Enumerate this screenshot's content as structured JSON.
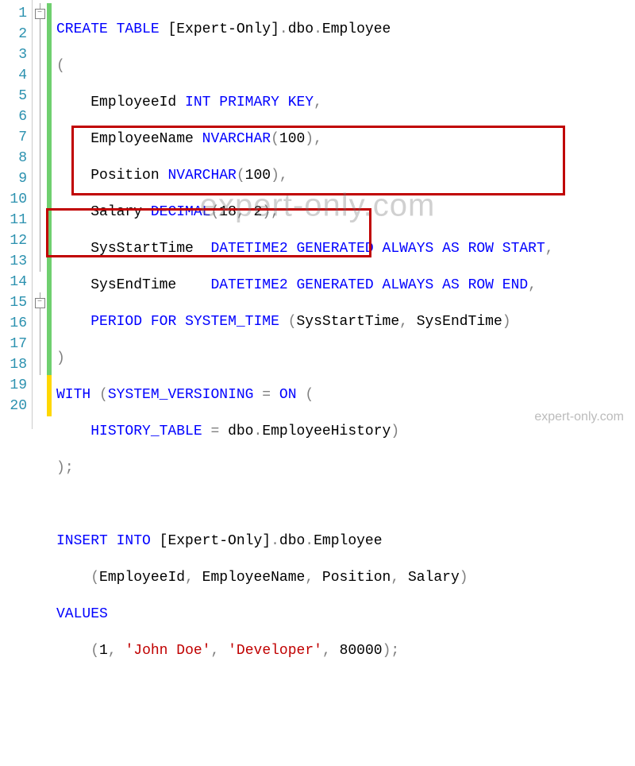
{
  "watermark": "expert-only.com",
  "corner_mark": "expert-only.com",
  "gutter": [
    "1",
    "2",
    "3",
    "4",
    "5",
    "6",
    "7",
    "8",
    "9",
    "10",
    "11",
    "12",
    "13",
    "14",
    "15",
    "16",
    "17",
    "18",
    "19",
    "20"
  ],
  "fold": {
    "minus": "−"
  },
  "lines": {
    "l1": {
      "a": "CREATE",
      "b": " ",
      "c": "TABLE",
      "d": " [Expert-Only]",
      "e": ".",
      "f": "dbo",
      "g": ".",
      "h": "Employee"
    },
    "l2": {
      "a": "(",
      "pad": ""
    },
    "l3": {
      "a": "EmployeeId ",
      "b": "INT",
      "c": " ",
      "d": "PRIMARY",
      "e": " ",
      "f": "KEY",
      "g": ","
    },
    "l4": {
      "a": "EmployeeName ",
      "b": "NVARCHAR",
      "c": "(",
      "d": "100",
      "e": ")",
      "f": ","
    },
    "l5": {
      "a": "Position ",
      "b": "NVARCHAR",
      "c": "(",
      "d": "100",
      "e": ")",
      "f": ","
    },
    "l6": {
      "a": "Salary ",
      "b": "DECIMAL",
      "c": "(",
      "d": "18",
      "e": ",",
      "f": " ",
      "g": "2",
      "h": ")",
      "i": ","
    },
    "l7": {
      "a": "SysStartTime  ",
      "b": "DATETIME2",
      "c": " ",
      "d": "GENERATED",
      "e": " ",
      "f": "ALWAYS",
      "g": " ",
      "h": "AS",
      "i": " ",
      "j": "ROW",
      "k": " ",
      "l": "START",
      "m": ","
    },
    "l8": {
      "a": "SysEndTime    ",
      "b": "DATETIME2",
      "c": " ",
      "d": "GENERATED",
      "e": " ",
      "f": "ALWAYS",
      "g": " ",
      "h": "AS",
      "i": " ",
      "j": "ROW",
      "k": " ",
      "l": "END",
      "m": ","
    },
    "l9": {
      "a": "PERIOD",
      "b": " ",
      "c": "FOR",
      "d": " ",
      "e": "SYSTEM_TIME",
      "f": " (",
      "g": "SysStartTime",
      "h": ",",
      "i": " SysEndTime",
      "j": ")"
    },
    "l10": {
      "a": ")"
    },
    "l11": {
      "a": "WITH",
      "b": " ",
      "c": "(",
      "d": "SYSTEM_VERSIONING",
      "e": " ",
      "f": "=",
      "g": " ",
      "h": "ON",
      "i": " ("
    },
    "l12": {
      "a": "HISTORY_TABLE",
      "b": " ",
      "c": "=",
      "d": " dbo",
      "e": ".",
      "f": "EmployeeHistory",
      "g": ")"
    },
    "l13": {
      "a": ")",
      "b": ";"
    },
    "l15": {
      "a": "INSERT",
      "b": " ",
      "c": "INTO",
      "d": " [Expert-Only]",
      "e": ".",
      "f": "dbo",
      "g": ".",
      "h": "Employee"
    },
    "l16": {
      "a": "(",
      "b": "EmployeeId",
      "c": ",",
      "d": " EmployeeName",
      "e": ",",
      "f": " Position",
      "g": ",",
      "h": " Salary",
      "i": ")"
    },
    "l17": {
      "a": "VALUES"
    },
    "l18": {
      "a": "(",
      "b": "1",
      "c": ",",
      "d": " ",
      "e": "'John Doe'",
      "f": ",",
      "g": " ",
      "h": "'Developer'",
      "i": ",",
      "j": " ",
      "k": "80000",
      "l": ")",
      "m": ";"
    }
  }
}
